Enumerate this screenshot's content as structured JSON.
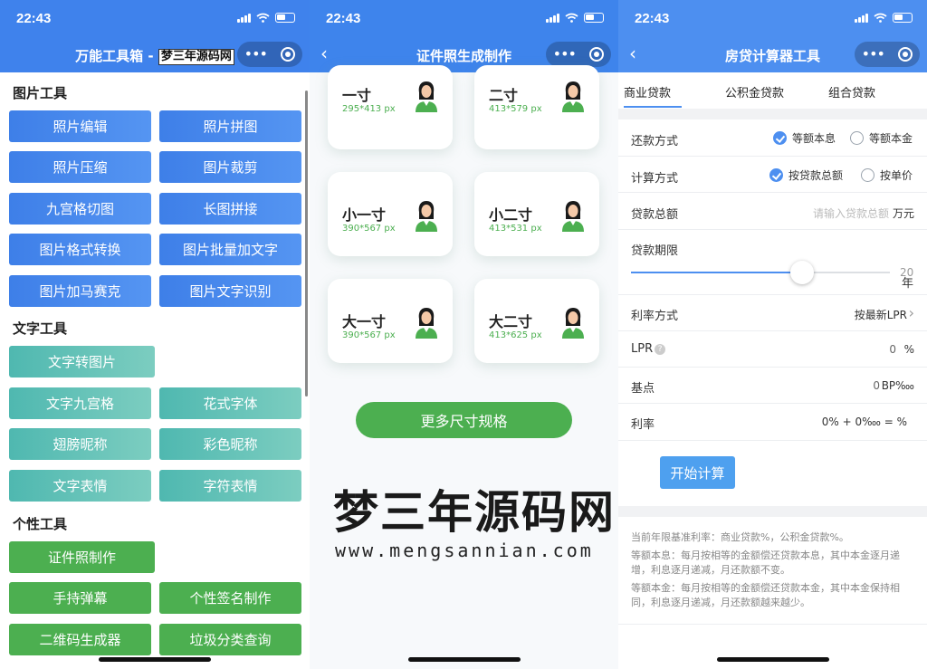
{
  "status": {
    "time": "22:43"
  },
  "screen1": {
    "title_prefix": "万能工具箱 -",
    "title_badge": "梦三年源码网",
    "sections": {
      "image_tools": "图片工具",
      "text_tools": "文字工具",
      "personal_tools": "个性工具"
    },
    "image_buttons": [
      "照片编辑",
      "照片拼图",
      "照片压缩",
      "图片裁剪",
      "九宫格切图",
      "长图拼接",
      "图片格式转换",
      "图片批量加文字",
      "图片加马赛克",
      "图片文字识别"
    ],
    "text_buttons": [
      "文字转图片",
      "文字九宫格",
      "花式字体",
      "翅膀昵称",
      "彩色昵称",
      "文字表情",
      "字符表情"
    ],
    "personal_buttons": [
      "证件照制作",
      "手持弹幕",
      "个性签名制作",
      "二维码生成器",
      "垃圾分类查询"
    ]
  },
  "screen2": {
    "title": "证件照生成制作",
    "cards": [
      {
        "name": "一寸",
        "size": "295*413 px"
      },
      {
        "name": "二寸",
        "size": "413*579 px"
      },
      {
        "name": "小一寸",
        "size": "390*567 px"
      },
      {
        "name": "小二寸",
        "size": "413*531 px"
      },
      {
        "name": "大一寸",
        "size": "390*567 px"
      },
      {
        "name": "大二寸",
        "size": "413*625 px"
      }
    ],
    "more_button": "更多尺寸规格"
  },
  "screen3": {
    "title": "房贷计算器工具",
    "tabs": [
      "商业贷款",
      "公积金贷款",
      "组合贷款"
    ],
    "repay_label": "还款方式",
    "repay_opt1": "等额本息",
    "repay_opt2": "等额本金",
    "calc_label": "计算方式",
    "calc_opt1": "按贷款总额",
    "calc_opt2": "按单价",
    "total_label": "贷款总额",
    "total_placeholder": "请输入贷款总额",
    "total_unit": "万元",
    "term_label": "贷款期限",
    "term_value": "20",
    "term_unit": "年",
    "term_fraction": 0.66,
    "rate_mode_label": "利率方式",
    "rate_mode_value": "按最新LPR",
    "lpr_label": "LPR",
    "lpr_value": "0",
    "lpr_unit": "%",
    "bp_label": "基点",
    "bp_value": "0",
    "bp_unit": "BP‱",
    "rate_label": "利率",
    "rate_value": "0% + 0‱ = %",
    "calc_button": "开始计算",
    "note1": "当前年限基准利率：商业贷款%，公积金贷款%。",
    "note2": "等额本息：每月按相等的金额偿还贷款本息，其中本金逐月递增，利息逐月递减，月还款额不变。",
    "note3": "等额本金：每月按相等的金额偿还贷款本金，其中本金保持相同，利息逐月递减，月还款额越来越少。"
  },
  "watermark": {
    "text": "梦三年源码网",
    "url": "www.mengsannian.com"
  },
  "colors": {
    "header_blue": "#3f82ec",
    "button_blue": "#3e7fe8",
    "button_teal": "#4fb8b0",
    "button_green": "#4caf50",
    "accent_blue": "#4d8ff0"
  }
}
